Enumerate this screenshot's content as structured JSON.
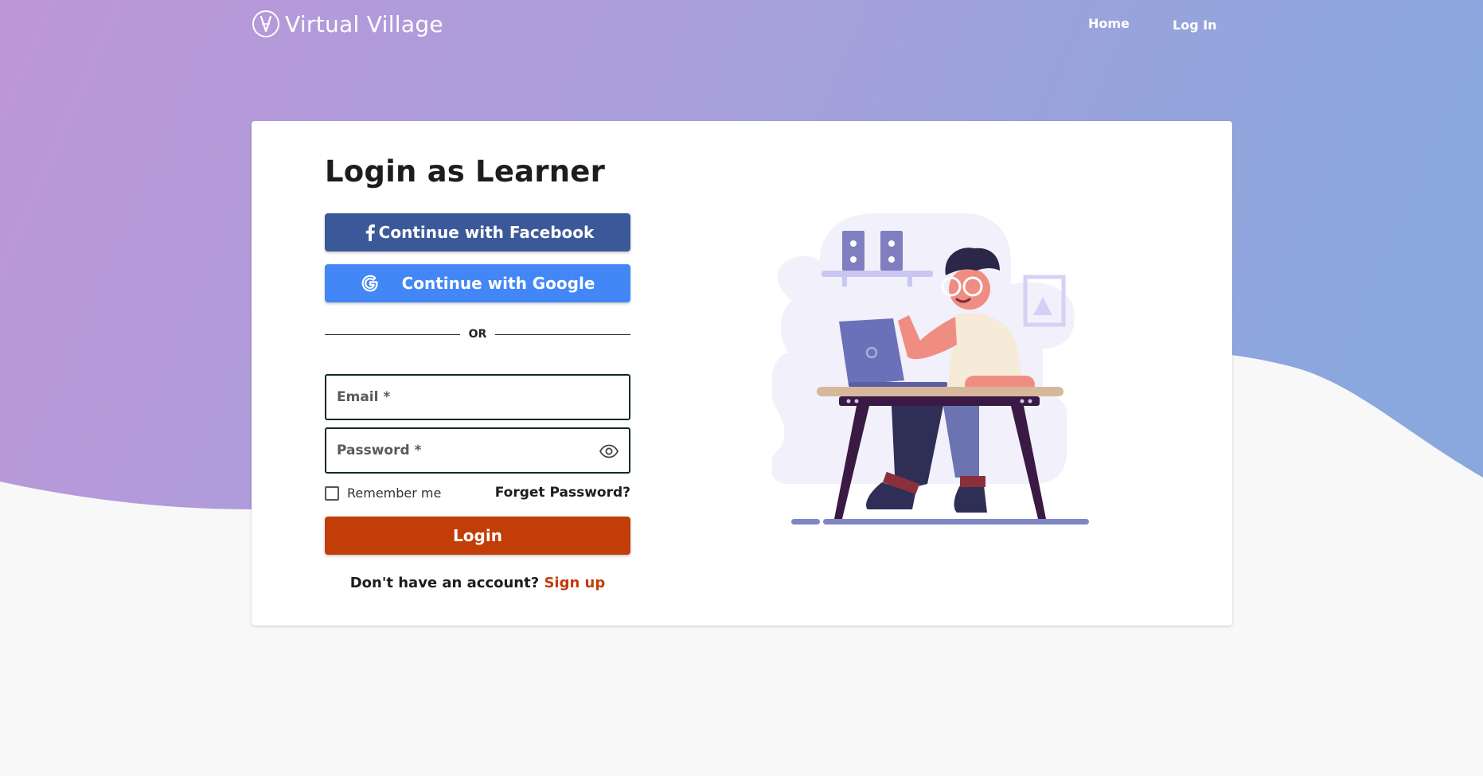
{
  "header": {
    "brand": "Virtual Village",
    "nav": {
      "home": "Home",
      "login": "Log In"
    }
  },
  "login": {
    "title": "Login as Learner",
    "facebook_button": "Continue with Facebook",
    "google_button": "Continue with Google",
    "divider": "OR",
    "email": {
      "placeholder": "Email *",
      "value": ""
    },
    "password": {
      "placeholder": "Password *",
      "value": ""
    },
    "remember_me": "Remember me",
    "forgot_password": "Forget Password?",
    "submit": "Login",
    "signup_prompt": "Don't have an account?",
    "signup_link": "Sign up"
  },
  "colors": {
    "gradient_start": "#bd96d9",
    "gradient_end": "#8aa7de",
    "facebook": "#3b5898",
    "google": "#4287f5",
    "primary": "#c23d08",
    "page_bg": "#f8f8f8"
  },
  "icons": {
    "logo": "brand-logo-icon",
    "facebook": "facebook-icon",
    "google": "google-icon",
    "password_toggle": "eye-icon"
  }
}
